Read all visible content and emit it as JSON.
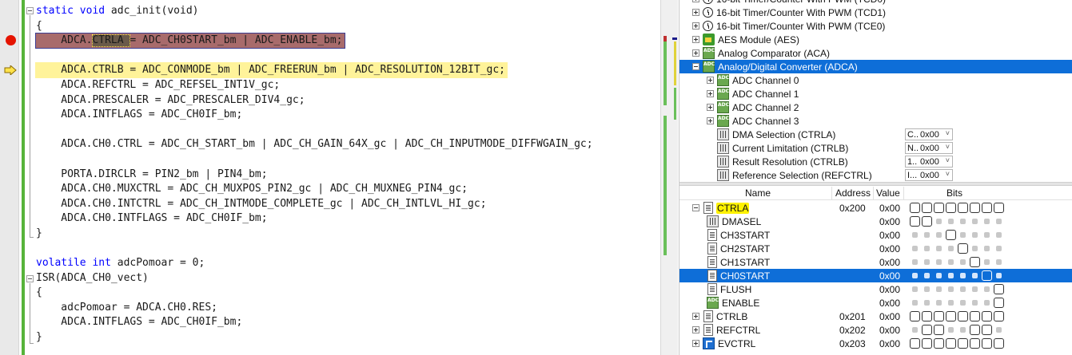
{
  "editor": {
    "lines": [
      {
        "kw": "static void",
        "text": " adc_init(void)"
      },
      {
        "kw": "",
        "text": "{"
      },
      {
        "kw": "",
        "text": "    ADCA.CTRLA = ADC_CH0START_bm | ADC_ENABLE_bm;"
      },
      {
        "kw": "",
        "text": ""
      },
      {
        "kw": "",
        "text": "    ADCA.CTRLB = ADC_CONMODE_bm | ADC_FREERUN_bm | ADC_RESOLUTION_12BIT_gc;"
      },
      {
        "kw": "",
        "text": "    ADCA.REFCTRL = ADC_REFSEL_INT1V_gc;"
      },
      {
        "kw": "",
        "text": "    ADCA.PRESCALER = ADC_PRESCALER_DIV4_gc;"
      },
      {
        "kw": "",
        "text": "    ADCA.INTFLAGS = ADC_CH0IF_bm;"
      },
      {
        "kw": "",
        "text": ""
      },
      {
        "kw": "",
        "text": "    ADCA.CH0.CTRL = ADC_CH_START_bm | ADC_CH_GAIN_64X_gc | ADC_CH_INPUTMODE_DIFFWGAIN_gc;"
      },
      {
        "kw": "",
        "text": ""
      },
      {
        "kw": "",
        "text": "    PORTA.DIRCLR = PIN2_bm | PIN4_bm;"
      },
      {
        "kw": "",
        "text": "    ADCA.CH0.MUXCTRL = ADC_CH_MUXPOS_PIN2_gc | ADC_CH_MUXNEG_PIN4_gc;"
      },
      {
        "kw": "",
        "text": "    ADCA.CH0.INTCTRL = ADC_CH_INTMODE_COMPLETE_gc | ADC_CH_INTLVL_HI_gc;"
      },
      {
        "kw": "",
        "text": "    ADCA.CH0.INTFLAGS = ADC_CH0IF_bm;"
      },
      {
        "kw": "",
        "text": "}"
      },
      {
        "kw": "",
        "text": ""
      },
      {
        "kw": "volatile int",
        "text": " adcPomoar = 0;"
      },
      {
        "kw": "",
        "text": "ISR(ADCA_CH0_vect)"
      },
      {
        "kw": "",
        "text": "{"
      },
      {
        "kw": "",
        "text": "    adcPomoar = ADCA.CH0.RES;"
      },
      {
        "kw": "",
        "text": "    ADCA.INTFLAGS = ADC_CH0IF_bm;"
      },
      {
        "kw": "",
        "text": "}"
      }
    ],
    "colors": {
      "breakpoint": "#e51400",
      "current_line": "#fff39a",
      "change_bar": "#57b33a",
      "keyword": "#0000ff"
    }
  },
  "tree": {
    "rows": [
      {
        "label": "16-bit Timer/Counter With PWM (TCD0)",
        "icon": "clock-icon",
        "exp": "plus"
      },
      {
        "label": "16-bit Timer/Counter With PWM (TCD1)",
        "icon": "clock-icon",
        "exp": "plus"
      },
      {
        "label": "16-bit Timer/Counter With PWM (TCE0)",
        "icon": "clock-icon",
        "exp": "plus"
      },
      {
        "label": "AES Module (AES)",
        "icon": "lock-icon",
        "exp": "plus"
      },
      {
        "label": "Analog Comparator (ACA)",
        "icon": "adc-icon",
        "exp": "plus"
      },
      {
        "label": "Analog/Digital Converter (ADCA)",
        "icon": "adc-icon",
        "exp": "minus",
        "selected": true
      },
      {
        "label": "ADC Channel 0",
        "icon": "adc-icon",
        "exp": "plus",
        "indent": 1
      },
      {
        "label": "ADC Channel 1",
        "icon": "adc-icon",
        "exp": "plus",
        "indent": 1
      },
      {
        "label": "ADC Channel 2",
        "icon": "adc-icon",
        "exp": "plus",
        "indent": 1
      },
      {
        "label": "ADC Channel 3",
        "icon": "adc-icon",
        "exp": "plus",
        "indent": 1
      },
      {
        "label": "DMA Selection (CTRLA)",
        "icon": "register-icon",
        "indent": 1,
        "combo": {
          "prefix": "C..",
          "value": "0x00"
        }
      },
      {
        "label": "Current Limitation (CTRLB)",
        "icon": "register-icon",
        "indent": 1,
        "combo": {
          "prefix": "N..",
          "value": "0x00"
        }
      },
      {
        "label": "Result Resolution (CTRLB)",
        "icon": "register-icon",
        "indent": 1,
        "combo": {
          "prefix": "1..",
          "value": "0x00"
        }
      },
      {
        "label": "Reference Selection (REFCTRL)",
        "icon": "register-icon",
        "indent": 1,
        "combo": {
          "prefix": "I...",
          "value": "0x00"
        }
      }
    ]
  },
  "registers": {
    "headers": {
      "name": "Name",
      "address": "Address",
      "value": "Value",
      "bits": "Bits"
    },
    "rows": [
      {
        "name": "CTRLA",
        "address": "0x200",
        "value": "0x00",
        "icon": "document-icon",
        "exp": "minus",
        "highlight": true,
        "bits": [
          0,
          0,
          0,
          0,
          0,
          0,
          0,
          0
        ]
      },
      {
        "name": "DMASEL",
        "address": "",
        "value": "0x00",
        "icon": "register-icon",
        "indent": 1,
        "bits": [
          0,
          0,
          1,
          1,
          1,
          1,
          1,
          1
        ]
      },
      {
        "name": "CH3START",
        "address": "",
        "value": "0x00",
        "icon": "document-icon",
        "indent": 1,
        "bits": [
          1,
          1,
          1,
          0,
          1,
          1,
          1,
          1
        ]
      },
      {
        "name": "CH2START",
        "address": "",
        "value": "0x00",
        "icon": "document-icon",
        "indent": 1,
        "bits": [
          1,
          1,
          1,
          1,
          0,
          1,
          1,
          1
        ]
      },
      {
        "name": "CH1START",
        "address": "",
        "value": "0x00",
        "icon": "document-icon",
        "indent": 1,
        "bits": [
          1,
          1,
          1,
          1,
          1,
          0,
          1,
          1
        ]
      },
      {
        "name": "CH0START",
        "address": "",
        "value": "0x00",
        "icon": "document-icon",
        "indent": 1,
        "selected": true,
        "bits": [
          1,
          1,
          1,
          1,
          1,
          1,
          0,
          1
        ]
      },
      {
        "name": "FLUSH",
        "address": "",
        "value": "0x00",
        "icon": "document-icon",
        "indent": 1,
        "bits": [
          1,
          1,
          1,
          1,
          1,
          1,
          1,
          0
        ]
      },
      {
        "name": "ENABLE",
        "address": "",
        "value": "0x00",
        "icon": "adc-icon",
        "indent": 1,
        "bits": [
          1,
          1,
          1,
          1,
          1,
          1,
          1,
          0
        ]
      },
      {
        "name": "CTRLB",
        "address": "0x201",
        "value": "0x00",
        "icon": "document-icon",
        "exp": "plus",
        "bits": [
          0,
          0,
          0,
          0,
          0,
          0,
          0,
          0
        ]
      },
      {
        "name": "REFCTRL",
        "address": "0x202",
        "value": "0x00",
        "icon": "document-icon",
        "exp": "plus",
        "bits": [
          1,
          0,
          0,
          1,
          1,
          0,
          0,
          1
        ]
      },
      {
        "name": "EVCTRL",
        "address": "0x203",
        "value": "0x00",
        "icon": "flag-icon",
        "exp": "plus",
        "bits": [
          0,
          0,
          0,
          0,
          0,
          0,
          0,
          0
        ]
      }
    ],
    "colors": {
      "selected": "#0e6ed8",
      "highlight": "#fff200"
    }
  }
}
